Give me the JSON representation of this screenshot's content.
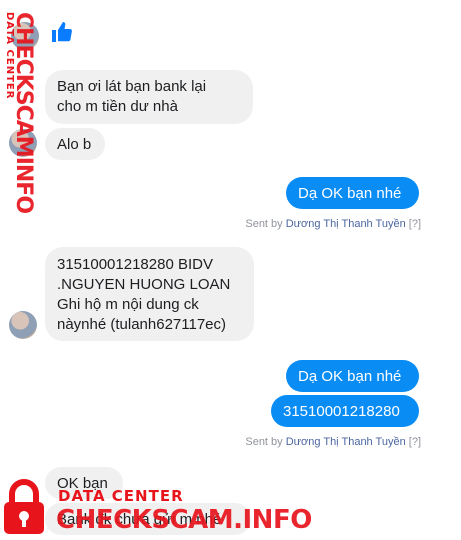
{
  "conversation": {
    "messages": [
      {
        "sender": "contact",
        "text": "Bạn ơi lát bạn bank lại\ncho m tiền dư nhà"
      },
      {
        "sender": "contact",
        "text": "Alo b"
      },
      {
        "sender": "me",
        "text": "Dạ OK bạn nhé"
      },
      {
        "sender": "contact",
        "text": "31510001218280 BIDV\n.NGUYEN HUONG LOAN\nGhi hộ m nội dung ck\nnàynhé (tulanh627117ec)"
      },
      {
        "sender": "me",
        "text": "Dạ OK bạn nhé"
      },
      {
        "sender": "me",
        "text": "31510001218280"
      },
      {
        "sender": "contact",
        "text": "OK bạn"
      },
      {
        "sender": "contact",
        "text": "Bank đk chưa gửi m nhé"
      }
    ],
    "sent_by": [
      {
        "prefix": "Sent by",
        "name": "Dương Thị Thanh Tuyền",
        "help": "[?]"
      },
      {
        "prefix": "Sent by",
        "name": "Dương Thị Thanh Tuyền",
        "help": "[?]"
      }
    ]
  },
  "watermark": {
    "label": "DATA CENTER",
    "brand_side": "CHECKSCAMINFO",
    "brand_bottom": "CHECKSCAM.INFO",
    "color": "#e8141c"
  },
  "colors": {
    "outgoing_bubble": "#0a8cf5",
    "incoming_bubble": "#f1f0f0",
    "sender_name": "#4b66a0"
  },
  "icons": {
    "like": "thumbs-up-icon",
    "lock": "padlock-icon"
  }
}
